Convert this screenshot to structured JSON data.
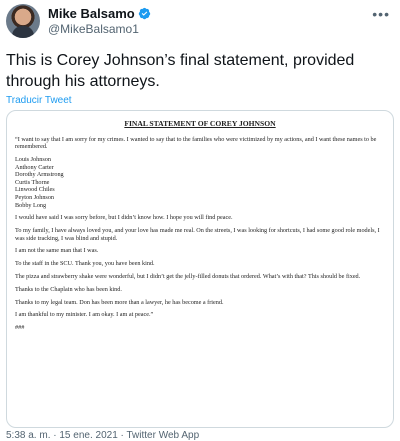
{
  "author": {
    "display_name": "Mike Balsamo",
    "handle": "@MikeBalsamo1",
    "verified": true
  },
  "menu_icon": "more-horizontal-icon",
  "tweet": {
    "text": "This is Corey Johnson’s final statement, provided through his attorneys.",
    "translate_label": "Traducir Tweet"
  },
  "document": {
    "title": "FINAL STATEMENT OF COREY JOHNSON",
    "intro": "“I want to say that I am sorry for my crimes. I wanted to say that to the families who were victimized by my actions, and I want these names to be remembered.",
    "names": [
      "Louis Johnson",
      "Anthony Carter",
      "Dorothy Armstrong",
      "Curtis Thorne",
      "Linwood Chiles",
      "Peyton Johnson",
      "Bobby Long"
    ],
    "paragraphs": [
      "I would have said I was sorry before, but I didn’t know how. I hope you will find peace.",
      "To my family, I have always loved you, and your love has made me real. On the streets, I was looking for shortcuts, I had some good role models, I was side tracking, I was blind and stupid.",
      "I am not the same man that I was.",
      "To the staff in the SCU. Thank you, you have been kind.",
      "The pizza and strawberry shake were wonderful, but I didn’t get the jelly-filled donuts that ordered. What’s with that? This should be fixed.",
      "Thanks to the Chaplain who has been kind.",
      "Thanks to my legal team. Don has been more than a lawyer, he has become a friend.",
      "I am thankful to my minister. I am okay. I am at peace.”",
      "###"
    ]
  },
  "meta": {
    "time": "5:38 a. m.",
    "separator": "·",
    "date": "15 ene. 2021",
    "app": "Twitter Web App"
  },
  "colors": {
    "link": "#1d9bf0",
    "verified": "#1d9bf0",
    "muted": "#536471"
  }
}
